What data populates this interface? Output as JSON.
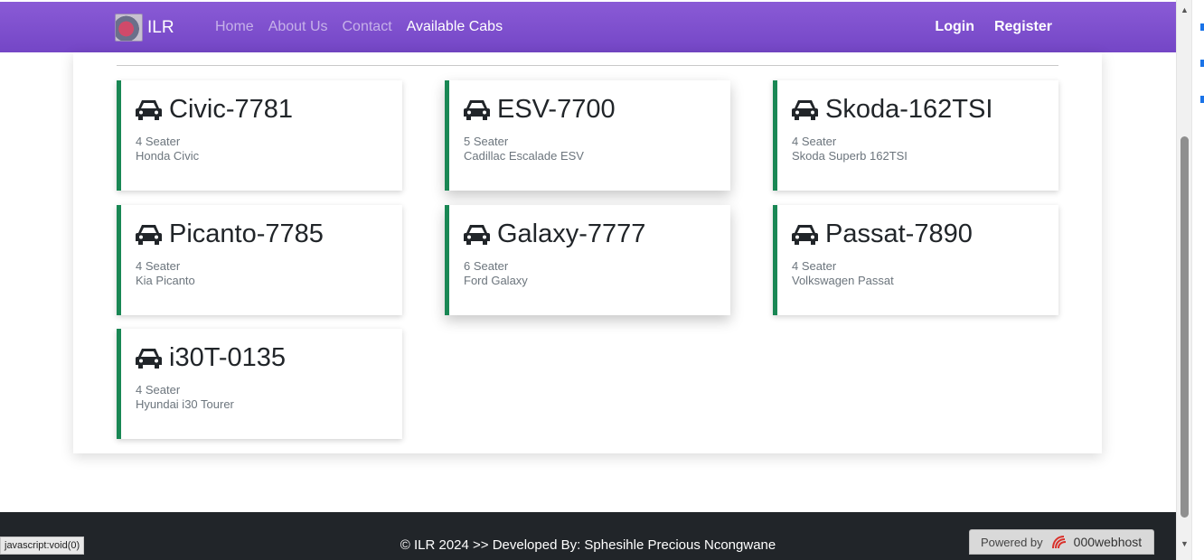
{
  "navbar": {
    "brand": "ILR",
    "links": [
      {
        "label": "Home",
        "active": false
      },
      {
        "label": "About Us",
        "active": false
      },
      {
        "label": "Contact",
        "active": false
      },
      {
        "label": "Available Cabs",
        "active": true
      }
    ],
    "login": "Login",
    "register": "Register"
  },
  "cabs": [
    {
      "plate": "Civic-7781",
      "seats": "4 Seater",
      "model": "Honda Civic"
    },
    {
      "plate": "ESV-7700",
      "seats": "5 Seater",
      "model": "Cadillac Escalade ESV"
    },
    {
      "plate": "Skoda-162TSI",
      "seats": "4 Seater",
      "model": "Skoda Superb 162TSI"
    },
    {
      "plate": "Picanto-7785",
      "seats": "4 Seater",
      "model": "Kia Picanto"
    },
    {
      "plate": "Galaxy-7777",
      "seats": "6 Seater",
      "model": "Ford Galaxy"
    },
    {
      "plate": "Passat-7890",
      "seats": "4 Seater",
      "model": "Volkswagen Passat"
    },
    {
      "plate": "i30T-0135",
      "seats": "4 Seater",
      "model": "Hyundai i30 Tourer"
    }
  ],
  "footer": {
    "text": "© ILR 2024 >> Developed By: Sphesihle Precious Ncongwane"
  },
  "status_bar": "javascript:void(0)",
  "hosting_badge": {
    "prefix": "Powered by",
    "brand": "000webhost"
  },
  "colors": {
    "navbar": "#7c4dcc",
    "card_accent": "#198754",
    "footer": "#212529"
  }
}
